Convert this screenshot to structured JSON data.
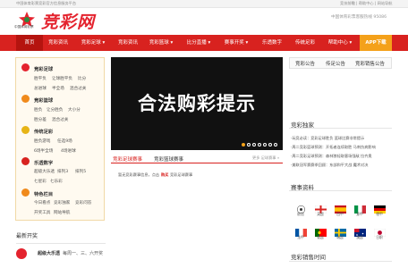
{
  "top_bar": {
    "notice": "中国体育彩票竞彩官方信息服务平台",
    "links": "竞技前瞻 | 帮助中心 | 网站导航"
  },
  "header": {
    "logo_caption": "中国体育彩票",
    "logo_text": "竞彩网",
    "hotline": "中国体育彩票客服热线 95086"
  },
  "nav": {
    "items": [
      {
        "label": "首页"
      },
      {
        "label": "竞彩资讯"
      },
      {
        "label": "竞彩足球 ▾"
      },
      {
        "label": "竞彩资讯"
      },
      {
        "label": "竞彩篮球 ▾"
      },
      {
        "label": "比分直播 ▾"
      },
      {
        "label": "赛事开奖 ▾"
      },
      {
        "label": "乐透数字"
      },
      {
        "label": "传统足彩"
      },
      {
        "label": "帮助中心 ▾"
      },
      {
        "label": "APP下载"
      }
    ]
  },
  "sidebar": {
    "groups": [
      {
        "title": "竞彩足球",
        "links": [
          "胜平负",
          "让球胜平负",
          "比分",
          "总进球",
          "半全场",
          "混合过关"
        ]
      },
      {
        "title": "竞彩篮球",
        "links": [
          "胜负",
          "让分胜负",
          "大小分",
          "胜分差",
          "混合过关"
        ]
      },
      {
        "title": "传统足彩",
        "links": [
          "胜负游戏",
          "任选9场",
          "6场半全场",
          "4场进球"
        ]
      },
      {
        "title": "乐透数字",
        "links": [
          "超级大乐透",
          "排列3",
          "排列5",
          "七星彩",
          "七乐彩"
        ]
      },
      {
        "title": "特色栏目",
        "links": [
          "今日看点",
          "竞彩独家",
          "竞彩问答",
          "开奖工具",
          "网站导航"
        ]
      }
    ]
  },
  "banner": {
    "text": "合法购彩提示",
    "dots": 7
  },
  "match_section": {
    "tab_active": "竞彩足球赛事",
    "tab_other": "竞彩篮球赛事",
    "more_label": "更多 足球赛事 »",
    "notice": "暂无竞彩赛事信息，点击",
    "notice_link": "购买",
    "notice_tail": "竞彩足球赛事"
  },
  "right_tabs": [
    "竞彩公告",
    "传足公告",
    "竞彩销售公告"
  ],
  "independent": {
    "title": "竞彩独家",
    "items": [
      "·玩竞必读：竞彩足球胜负 篮球比赛非常提示",
      "·周二竞彩篮球预测：开拓者连续取胜 马刺伤病影响",
      "·周二竞彩足球预测：森林狼轻取客场强敌 拉齐奥",
      "·美联冠军赛赛季回顾：东部和平大战 魔术对决"
    ]
  },
  "events": {
    "title": "赛事资料",
    "flags": [
      {
        "icon": "football-icon",
        "label": "欧冠"
      },
      {
        "icon": "england-flag-icon",
        "label": "英超"
      },
      {
        "icon": "spain-flag-icon",
        "label": "西甲"
      },
      {
        "icon": "italy-flag-icon",
        "label": "意甲"
      },
      {
        "icon": "germany-flag-icon",
        "label": "德甲"
      },
      {
        "icon": "france-flag-icon",
        "label": "法甲"
      },
      {
        "icon": "portugal-flag-icon",
        "label": "葡超"
      },
      {
        "icon": "sweden-flag-icon",
        "label": "瑞超"
      },
      {
        "icon": "australia-flag-icon",
        "label": "澳超"
      },
      {
        "icon": "japan-flag-icon",
        "label": "日职"
      }
    ]
  },
  "sales_time": {
    "title": "竞彩销售时间"
  },
  "recent_draw": {
    "title": "最新开奖",
    "game": "超级大乐透",
    "schedule": "每周一、三、六开奖"
  },
  "colors": {
    "brand_red": "#d8221f",
    "accent_orange": "#f4a11a"
  }
}
